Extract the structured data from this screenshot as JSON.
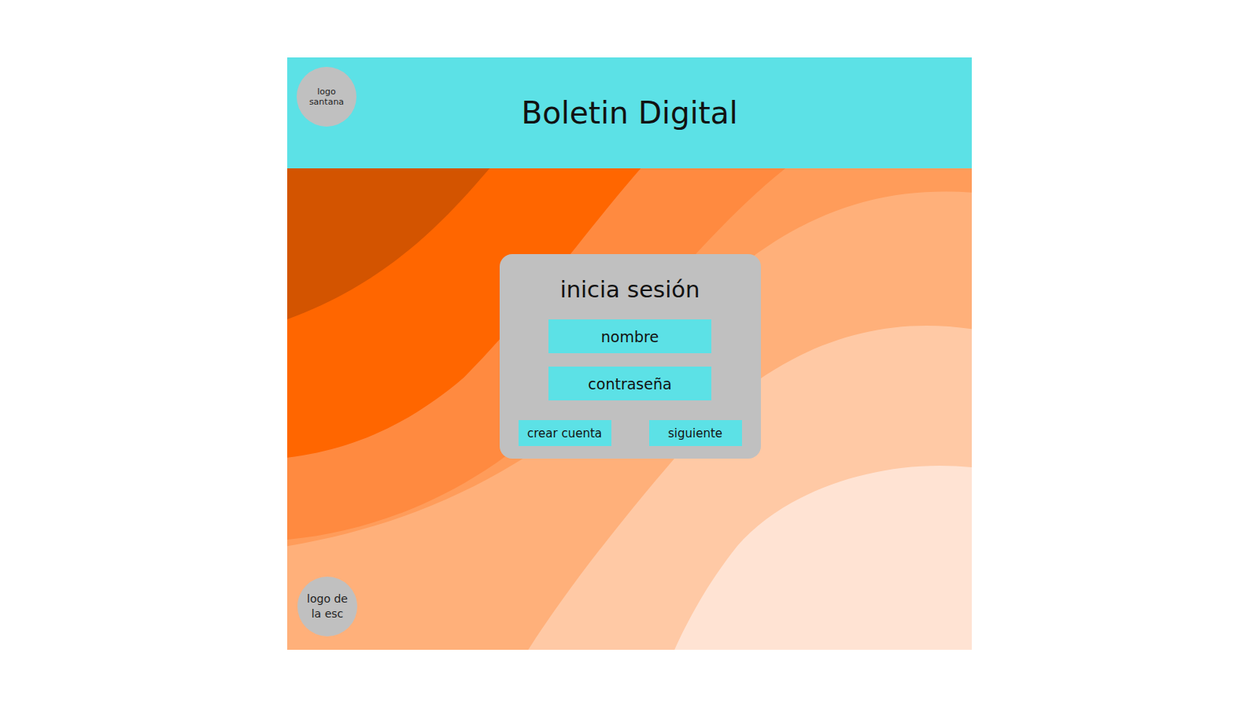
{
  "header": {
    "title": "Boletin Digital",
    "logo": "logo santana"
  },
  "login": {
    "title": "inicia sesión",
    "fields": [
      {
        "placeholder": "nombre"
      },
      {
        "placeholder": "contraseña"
      }
    ],
    "buttons": [
      "crear cuenta",
      "siguiente"
    ]
  },
  "footer_logo": "logo de la esc"
}
